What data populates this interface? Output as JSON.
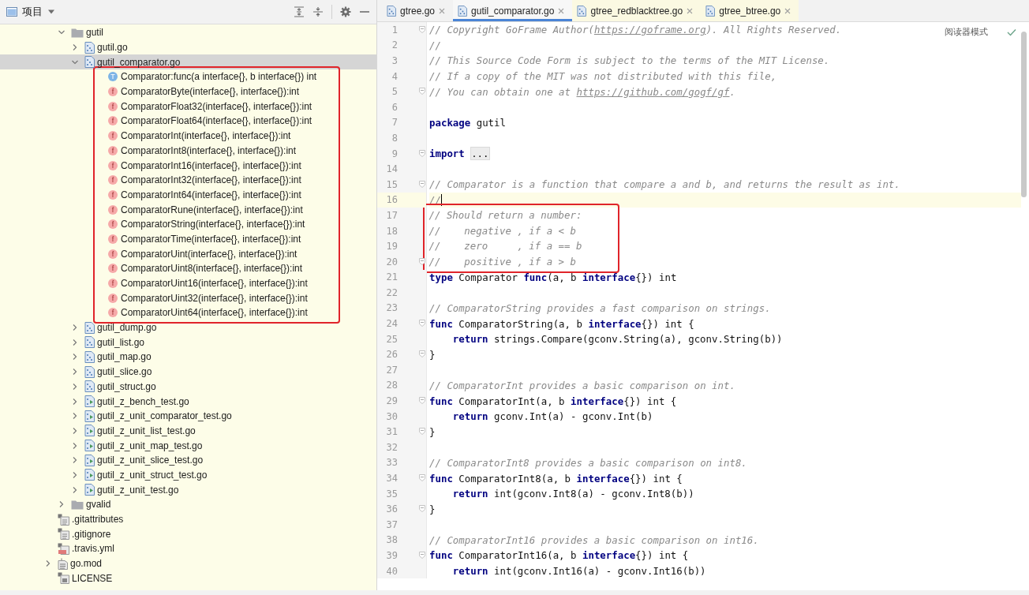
{
  "project_panel": {
    "title": "项目"
  },
  "tree": {
    "items": [
      {
        "children": [
          {
            "label": "gutil",
            "kind": "folder",
            "expanded": true,
            "selected": false,
            "children": [
              {
                "label": "gutil.go",
                "kind": "go",
                "expanded": false,
                "selected": false
              },
              {
                "label": "gutil_comparator.go",
                "kind": "go",
                "expanded": true,
                "selected": true,
                "boxed": true,
                "children": [
                  {
                    "label": "Comparator:func(a interface{}, b interface{}) int",
                    "kind": "type",
                    "badge": "T",
                    "selected": false
                  },
                  {
                    "label": "ComparatorByte(interface{}, interface{}):int",
                    "kind": "func",
                    "badge": "f",
                    "selected": false
                  },
                  {
                    "label": "ComparatorFloat32(interface{}, interface{}):int",
                    "kind": "func",
                    "badge": "f",
                    "selected": false
                  },
                  {
                    "label": "ComparatorFloat64(interface{}, interface{}):int",
                    "kind": "func",
                    "badge": "f",
                    "selected": false
                  },
                  {
                    "label": "ComparatorInt(interface{}, interface{}):int",
                    "kind": "func",
                    "badge": "f",
                    "selected": false
                  },
                  {
                    "label": "ComparatorInt8(interface{}, interface{}):int",
                    "kind": "func",
                    "badge": "f",
                    "selected": false
                  },
                  {
                    "label": "ComparatorInt16(interface{}, interface{}):int",
                    "kind": "func",
                    "badge": "f",
                    "selected": false
                  },
                  {
                    "label": "ComparatorInt32(interface{}, interface{}):int",
                    "kind": "func",
                    "badge": "f",
                    "selected": false
                  },
                  {
                    "label": "ComparatorInt64(interface{}, interface{}):int",
                    "kind": "func",
                    "badge": "f",
                    "selected": false
                  },
                  {
                    "label": "ComparatorRune(interface{}, interface{}):int",
                    "kind": "func",
                    "badge": "f",
                    "selected": false
                  },
                  {
                    "label": "ComparatorString(interface{}, interface{}):int",
                    "kind": "func",
                    "badge": "f",
                    "selected": false
                  },
                  {
                    "label": "ComparatorTime(interface{}, interface{}):int",
                    "kind": "func",
                    "badge": "f",
                    "selected": false
                  },
                  {
                    "label": "ComparatorUint(interface{}, interface{}):int",
                    "kind": "func",
                    "badge": "f",
                    "selected": false
                  },
                  {
                    "label": "ComparatorUint8(interface{}, interface{}):int",
                    "kind": "func",
                    "badge": "f",
                    "selected": false
                  },
                  {
                    "label": "ComparatorUint16(interface{}, interface{}):int",
                    "kind": "func",
                    "badge": "f",
                    "selected": false
                  },
                  {
                    "label": "ComparatorUint32(interface{}, interface{}):int",
                    "kind": "func",
                    "badge": "f",
                    "selected": false
                  },
                  {
                    "label": "ComparatorUint64(interface{}, interface{}):int",
                    "kind": "func",
                    "badge": "f",
                    "selected": false
                  }
                ]
              },
              {
                "label": "gutil_dump.go",
                "kind": "go",
                "expanded": false,
                "selected": false
              },
              {
                "label": "gutil_list.go",
                "kind": "go",
                "expanded": false,
                "selected": false
              },
              {
                "label": "gutil_map.go",
                "kind": "go",
                "expanded": false,
                "selected": false
              },
              {
                "label": "gutil_slice.go",
                "kind": "go",
                "expanded": false,
                "selected": false
              },
              {
                "label": "gutil_struct.go",
                "kind": "go",
                "expanded": false,
                "selected": false
              },
              {
                "label": "gutil_z_bench_test.go",
                "kind": "go-test",
                "expanded": false,
                "selected": false
              },
              {
                "label": "gutil_z_unit_comparator_test.go",
                "kind": "go-test",
                "expanded": false,
                "selected": false
              },
              {
                "label": "gutil_z_unit_list_test.go",
                "kind": "go-test",
                "expanded": false,
                "selected": false
              },
              {
                "label": "gutil_z_unit_map_test.go",
                "kind": "go-test",
                "expanded": false,
                "selected": false
              },
              {
                "label": "gutil_z_unit_slice_test.go",
                "kind": "go-test",
                "expanded": false,
                "selected": false
              },
              {
                "label": "gutil_z_unit_struct_test.go",
                "kind": "go-test",
                "expanded": false,
                "selected": false
              },
              {
                "label": "gutil_z_unit_test.go",
                "kind": "go-test",
                "expanded": false,
                "selected": false
              }
            ]
          },
          {
            "label": "gvalid",
            "kind": "folder",
            "expanded": false,
            "selected": false
          }
        ]
      },
      {
        "label": ".gitattributes",
        "kind": "config",
        "selected": false
      },
      {
        "label": ".gitignore",
        "kind": "config",
        "selected": false
      },
      {
        "label": ".travis.yml",
        "kind": "yaml",
        "selected": false
      },
      {
        "label": "go.mod",
        "kind": "gomod",
        "expanded": false,
        "selected": false
      },
      {
        "label": "LICENSE",
        "kind": "license",
        "selected": false
      }
    ]
  },
  "tabs": [
    {
      "label": "gtree.go",
      "selected": false,
      "color": "#f2f2f2"
    },
    {
      "label": "gutil_comparator.go",
      "selected": true,
      "color": "#f7f7f7"
    },
    {
      "label": "gtree_redblacktree.go",
      "selected": false,
      "color": "#fbf9e2"
    },
    {
      "label": "gtree_btree.go",
      "selected": false,
      "color": "#fbf9e2"
    }
  ],
  "editor": {
    "reader_mode": "阅读器模式",
    "blocks": [
      {
        "boxed": false,
        "lines": [
          {
            "n": "1",
            "fold": true,
            "current": false,
            "tokens": [
              {
                "kind": "comment",
                "text": "// Copyright GoFrame Author("
              },
              {
                "kind": "link",
                "text": "https://goframe.org"
              },
              {
                "kind": "comment",
                "text": "). All Rights Reserved."
              }
            ]
          },
          {
            "n": "2",
            "fold": false,
            "current": false,
            "tokens": [
              {
                "kind": "comment",
                "text": "//"
              }
            ]
          },
          {
            "n": "3",
            "fold": false,
            "current": false,
            "tokens": [
              {
                "kind": "comment",
                "text": "// This Source Code Form is subject to the terms of the MIT License."
              }
            ]
          },
          {
            "n": "4",
            "fold": false,
            "current": false,
            "tokens": [
              {
                "kind": "comment",
                "text": "// If a copy of the MIT was not distributed with this file,"
              }
            ]
          },
          {
            "n": "5",
            "fold": true,
            "current": false,
            "tokens": [
              {
                "kind": "comment",
                "text": "// You can obtain one at "
              },
              {
                "kind": "link",
                "text": "https://github.com/gogf/gf"
              },
              {
                "kind": "comment",
                "text": "."
              }
            ]
          },
          {
            "n": "6",
            "fold": false,
            "current": false
          },
          {
            "n": "7",
            "fold": false,
            "current": false,
            "tokens": [
              {
                "kind": "keyword",
                "text": "package"
              },
              {
                "kind": "plain",
                "text": " gutil"
              }
            ]
          },
          {
            "n": "8",
            "fold": false,
            "current": false
          },
          {
            "n": "9",
            "fold": true,
            "current": false,
            "tokens": [
              {
                "kind": "keyword",
                "text": "import"
              },
              {
                "kind": "folded",
                "text": "..."
              }
            ]
          },
          {
            "n": "14",
            "fold": false,
            "current": false
          },
          {
            "n": "15",
            "fold": true,
            "current": false,
            "tokens": [
              {
                "kind": "comment",
                "text": "// Comparator is a function that compare a and b, and returns the result as int."
              }
            ]
          },
          {
            "n": "16",
            "fold": false,
            "current": true,
            "tokens": [
              {
                "kind": "comment",
                "text": "//"
              }
            ]
          }
        ]
      },
      {
        "boxed": true,
        "lines": [
          {
            "n": "17",
            "fold": false,
            "current": false,
            "tokens": [
              {
                "kind": "comment",
                "text": "// Should return a number:"
              }
            ]
          },
          {
            "n": "18",
            "fold": false,
            "current": false,
            "tokens": [
              {
                "kind": "comment",
                "text": "//    negative , if a < b"
              }
            ]
          },
          {
            "n": "19",
            "fold": false,
            "current": false,
            "tokens": [
              {
                "kind": "comment",
                "text": "//    zero     , if a == b"
              }
            ]
          },
          {
            "n": "20",
            "fold": true,
            "current": false,
            "tokens": [
              {
                "kind": "comment",
                "text": "//    positive , if a > b"
              }
            ]
          }
        ]
      },
      {
        "boxed": false,
        "lines": [
          {
            "n": "21",
            "fold": false,
            "current": false,
            "tokens": [
              {
                "kind": "keyword",
                "text": "type"
              },
              {
                "kind": "plain",
                "text": " Comparator "
              },
              {
                "kind": "keyword",
                "text": "func"
              },
              {
                "kind": "plain",
                "text": "(a, b "
              },
              {
                "kind": "keyword",
                "text": "interface"
              },
              {
                "kind": "plain",
                "text": "{}) int"
              }
            ]
          },
          {
            "n": "22",
            "fold": false,
            "current": false
          },
          {
            "n": "23",
            "fold": false,
            "current": false,
            "tokens": [
              {
                "kind": "comment",
                "text": "// ComparatorString provides a fast comparison on strings."
              }
            ]
          },
          {
            "n": "24",
            "fold": true,
            "current": false,
            "tokens": [
              {
                "kind": "keyword",
                "text": "func"
              },
              {
                "kind": "plain",
                "text": " ComparatorString(a, b "
              },
              {
                "kind": "keyword",
                "text": "interface"
              },
              {
                "kind": "plain",
                "text": "{}) int {"
              }
            ]
          },
          {
            "n": "25",
            "fold": false,
            "current": false,
            "indented": true,
            "tokens": [
              {
                "kind": "keyword",
                "text": "return"
              },
              {
                "kind": "plain",
                "text": " strings.Compare(gconv.String(a), gconv.String(b))"
              }
            ]
          },
          {
            "n": "26",
            "fold": true,
            "current": false,
            "tokens": [
              {
                "kind": "plain",
                "text": "}"
              }
            ]
          },
          {
            "n": "27",
            "fold": false,
            "current": false
          },
          {
            "n": "28",
            "fold": false,
            "current": false,
            "tokens": [
              {
                "kind": "comment",
                "text": "// ComparatorInt provides a basic comparison on int."
              }
            ]
          },
          {
            "n": "29",
            "fold": true,
            "current": false,
            "tokens": [
              {
                "kind": "keyword",
                "text": "func"
              },
              {
                "kind": "plain",
                "text": " ComparatorInt(a, b "
              },
              {
                "kind": "keyword",
                "text": "interface"
              },
              {
                "kind": "plain",
                "text": "{}) int {"
              }
            ]
          },
          {
            "n": "30",
            "fold": false,
            "current": false,
            "indented": true,
            "tokens": [
              {
                "kind": "keyword",
                "text": "return"
              },
              {
                "kind": "plain",
                "text": " gconv.Int(a) - gconv.Int(b)"
              }
            ]
          },
          {
            "n": "31",
            "fold": true,
            "current": false,
            "tokens": [
              {
                "kind": "plain",
                "text": "}"
              }
            ]
          },
          {
            "n": "32",
            "fold": false,
            "current": false
          },
          {
            "n": "33",
            "fold": false,
            "current": false,
            "tokens": [
              {
                "kind": "comment",
                "text": "// ComparatorInt8 provides a basic comparison on int8."
              }
            ]
          },
          {
            "n": "34",
            "fold": true,
            "current": false,
            "tokens": [
              {
                "kind": "keyword",
                "text": "func"
              },
              {
                "kind": "plain",
                "text": " ComparatorInt8(a, b "
              },
              {
                "kind": "keyword",
                "text": "interface"
              },
              {
                "kind": "plain",
                "text": "{}) int {"
              }
            ]
          },
          {
            "n": "35",
            "fold": false,
            "current": false,
            "indented": true,
            "tokens": [
              {
                "kind": "keyword",
                "text": "return"
              },
              {
                "kind": "plain",
                "text": " int(gconv.Int8(a) - gconv.Int8(b))"
              }
            ]
          },
          {
            "n": "36",
            "fold": true,
            "current": false,
            "tokens": [
              {
                "kind": "plain",
                "text": "}"
              }
            ]
          },
          {
            "n": "37",
            "fold": false,
            "current": false
          },
          {
            "n": "38",
            "fold": false,
            "current": false,
            "tokens": [
              {
                "kind": "comment",
                "text": "// ComparatorInt16 provides a basic comparison on int16."
              }
            ]
          },
          {
            "n": "39",
            "fold": true,
            "current": false,
            "tokens": [
              {
                "kind": "keyword",
                "text": "func"
              },
              {
                "kind": "plain",
                "text": " ComparatorInt16(a, b "
              },
              {
                "kind": "keyword",
                "text": "interface"
              },
              {
                "kind": "plain",
                "text": "{}) int {"
              }
            ]
          },
          {
            "n": "40",
            "fold": false,
            "current": false,
            "indented": true,
            "tokens": [
              {
                "kind": "keyword",
                "text": "return"
              },
              {
                "kind": "plain",
                "text": " int(gconv.Int16(a) - gconv.Int16(b))"
              }
            ]
          }
        ]
      }
    ]
  }
}
